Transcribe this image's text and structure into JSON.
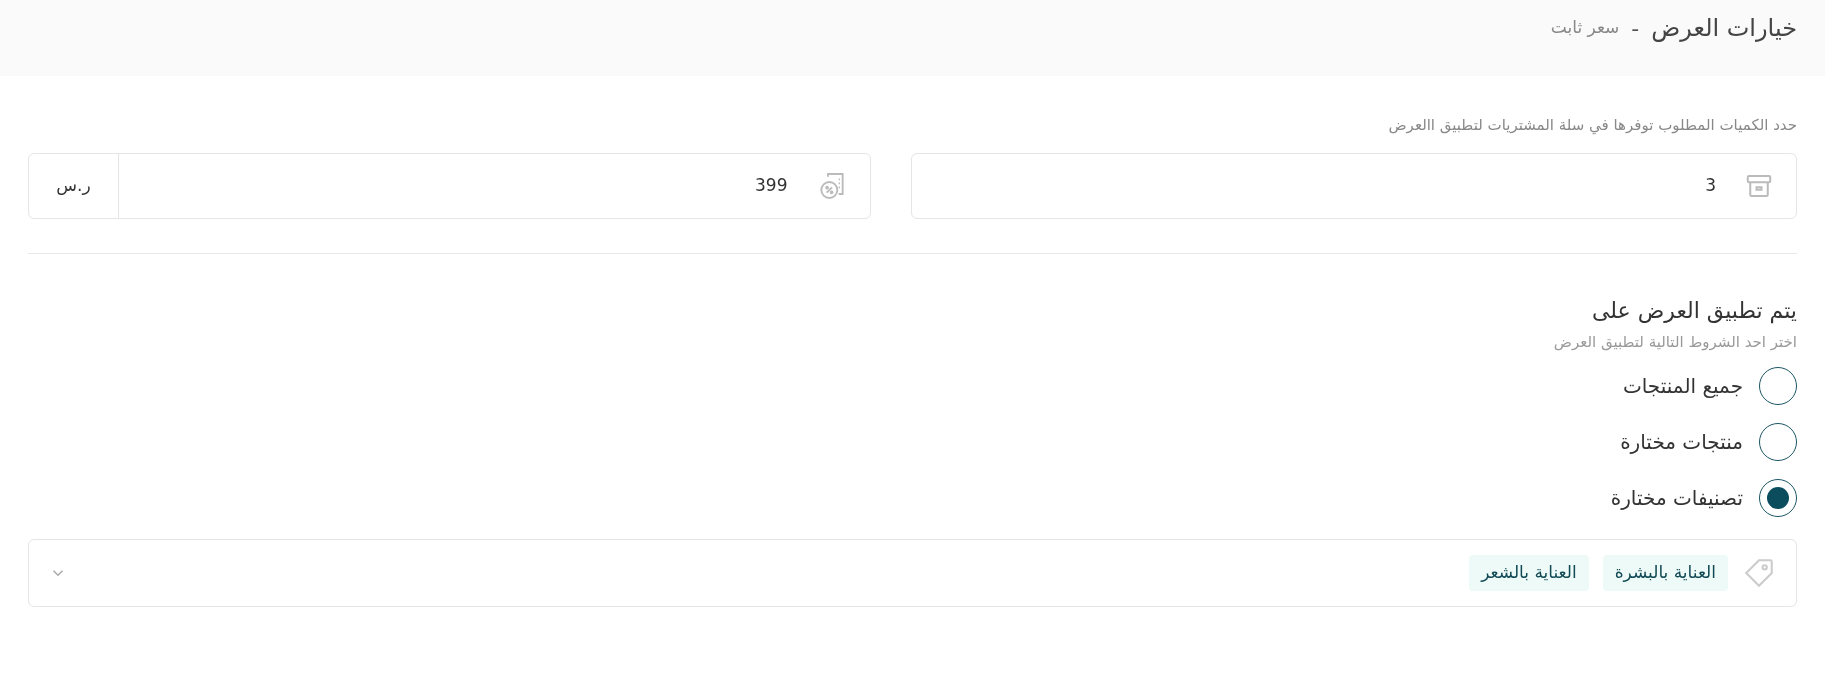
{
  "header": {
    "title": "خيارات العرض",
    "separator": "-",
    "subtitle": "سعر ثابت"
  },
  "quantity_hint": "حدد الكميات المطلوب توفرها في سلة المشتريات لتطبيق االعرض",
  "quantity_field": {
    "value": "3"
  },
  "price_field": {
    "value": "399",
    "currency": "ر.س"
  },
  "apply_section": {
    "title": "يتم تطبيق العرض على",
    "subtitle": "اختر احد الشروط التالية لتطبيق العرض",
    "options": [
      {
        "label": "جميع المنتجات",
        "selected": false
      },
      {
        "label": "منتجات مختارة",
        "selected": false
      },
      {
        "label": "تصنيفات مختارة",
        "selected": true
      }
    ]
  },
  "category_select": {
    "tags": [
      "العناية بالبشرة",
      "العناية بالشعر"
    ]
  }
}
